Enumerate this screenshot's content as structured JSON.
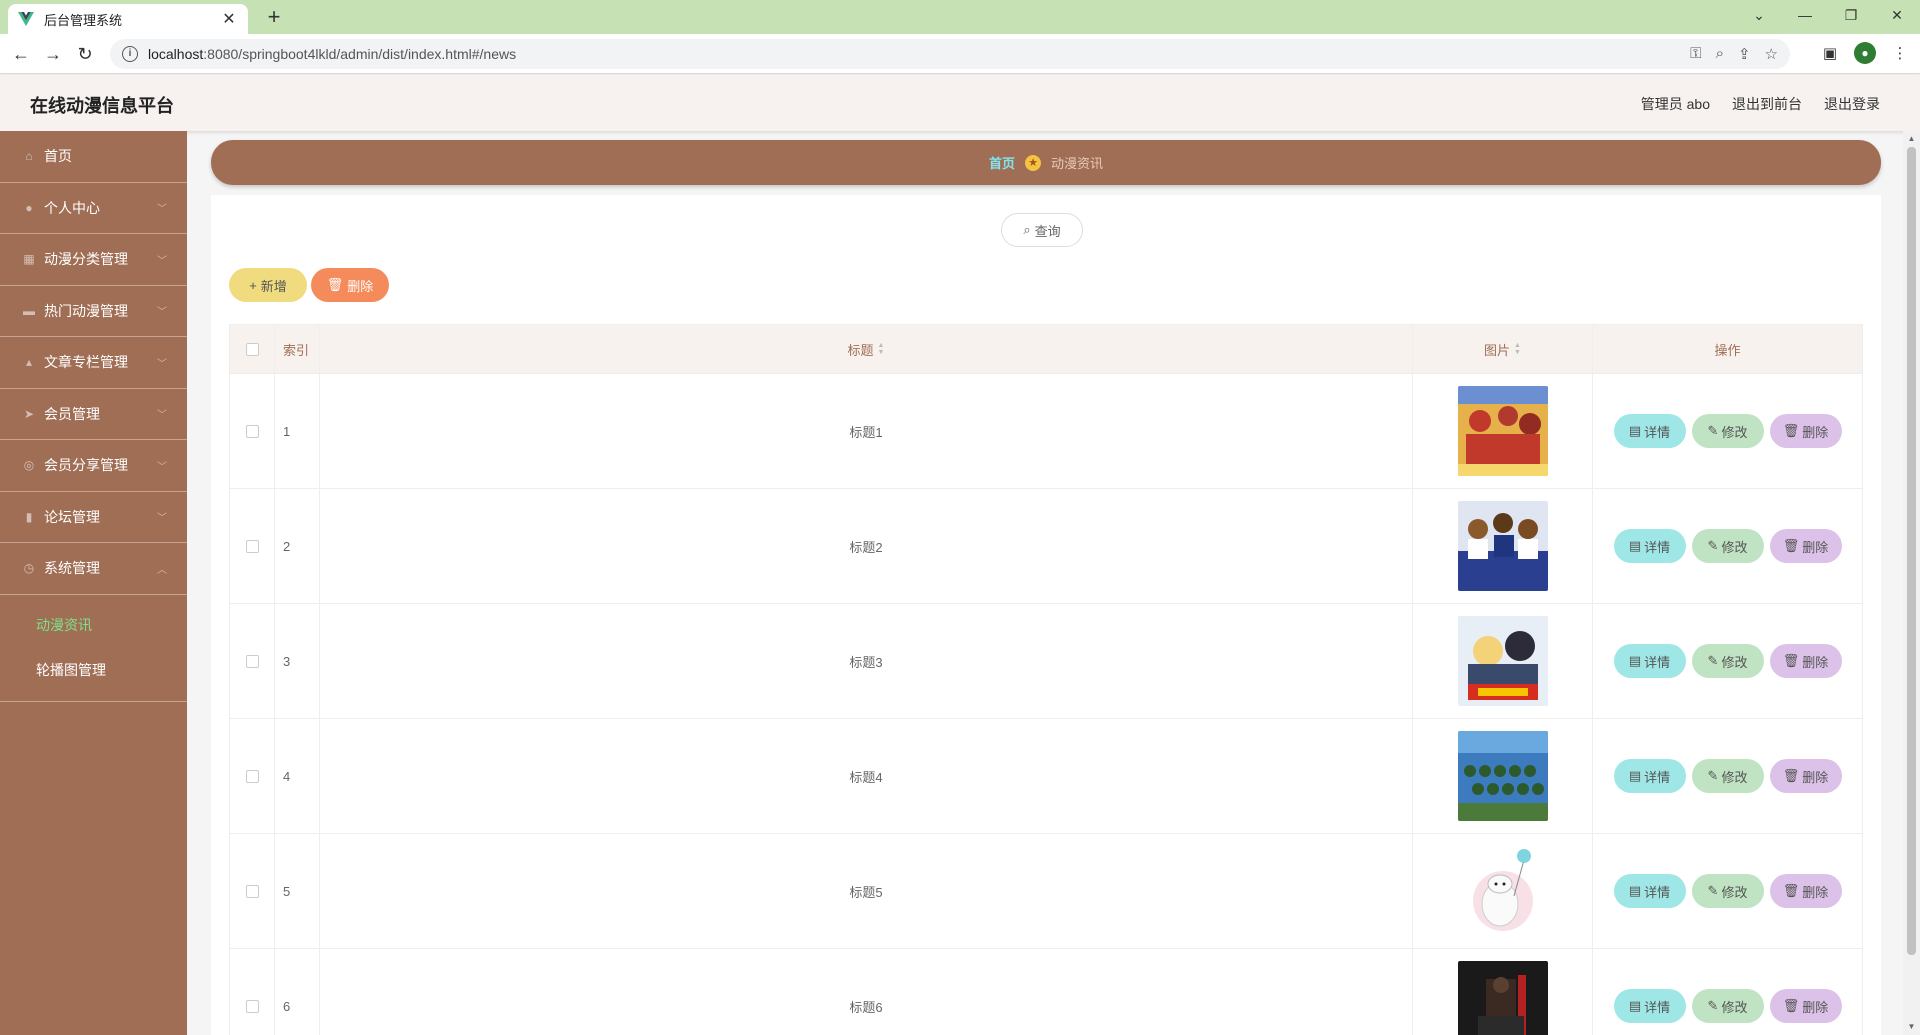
{
  "browser": {
    "tab_title": "后台管理系统",
    "url_host": "localhost",
    "url_rest": ":8080/springboot4lkld/admin/dist/index.html#/news"
  },
  "header": {
    "title": "在线动漫信息平台",
    "user": "管理员 abo",
    "to_front": "退出到前台",
    "logout": "退出登录"
  },
  "sidebar": {
    "items": [
      {
        "label": "首页",
        "icon": "home-icon"
      },
      {
        "label": "个人中心",
        "icon": "user-icon"
      },
      {
        "label": "动漫分类管理",
        "icon": "grid-icon"
      },
      {
        "label": "热门动漫管理",
        "icon": "tower-icon"
      },
      {
        "label": "文章专栏管理",
        "icon": "thumb-icon"
      },
      {
        "label": "会员管理",
        "icon": "send-icon"
      },
      {
        "label": "会员分享管理",
        "icon": "share-icon"
      },
      {
        "label": "论坛管理",
        "icon": "chart-icon"
      },
      {
        "label": "系统管理",
        "icon": "clock-icon"
      }
    ],
    "sub_items": [
      {
        "label": "动漫资讯",
        "active": true
      },
      {
        "label": "轮播图管理",
        "active": false
      }
    ]
  },
  "breadcrumb": {
    "home": "首页",
    "current": "动漫资讯"
  },
  "toolbar": {
    "search_label": "查询",
    "add_label": "新增",
    "delete_label": "删除"
  },
  "table": {
    "headers": {
      "index": "索引",
      "title": "标题",
      "image": "图片",
      "actions": "操作"
    },
    "rows": [
      {
        "index": "1",
        "title": "标题1"
      },
      {
        "index": "2",
        "title": "标题2"
      },
      {
        "index": "3",
        "title": "标题3"
      },
      {
        "index": "4",
        "title": "标题4"
      },
      {
        "index": "5",
        "title": "标题5"
      },
      {
        "index": "6",
        "title": "标题6"
      }
    ],
    "actions": {
      "detail": "详情",
      "edit": "修改",
      "delete": "删除"
    }
  },
  "colors": {
    "sidebar": "#a06e55",
    "active_submenu": "#7ee08a",
    "add_button": "#f0dc7e",
    "delete_button": "#f58b5a",
    "detail_button": "#9fe6e6",
    "edit_button": "#bfe3c3",
    "row_delete_button": "#dcc1e8"
  }
}
